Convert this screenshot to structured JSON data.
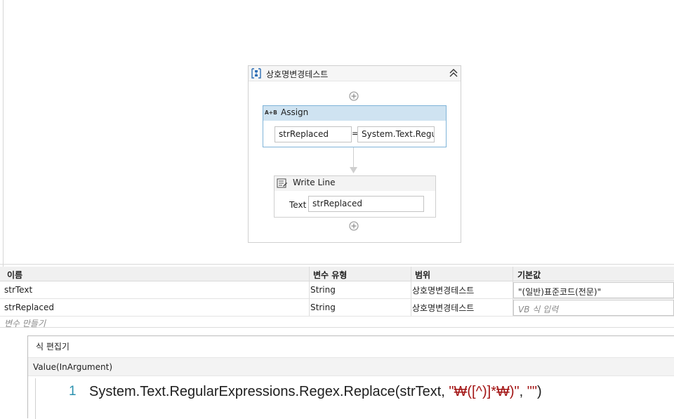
{
  "sequence": {
    "title": "상호명변경테스트",
    "assign": {
      "title": "Assign",
      "icon_label": "A+B",
      "to_value": "strReplaced",
      "equals": "=",
      "value_value": "System.Text.Regul"
    },
    "write_line": {
      "title": "Write Line",
      "text_label": "Text",
      "text_value": "strReplaced"
    }
  },
  "variables": {
    "headers": [
      "이름",
      "변수 유형",
      "범위",
      "기본값"
    ],
    "rows": [
      {
        "name": "strText",
        "type": "String",
        "scope": "상호명변경테스트",
        "default": "\"(일반)표준코드(전문)\""
      },
      {
        "name": "strReplaced",
        "type": "String",
        "scope": "상호명변경테스트",
        "default_placeholder": "VB 식 입력"
      }
    ],
    "create_label": "변수 만들기"
  },
  "expression_editor": {
    "title": "식 편집기",
    "argument_label": "Value(InArgument)",
    "line_number": "1",
    "code_prefix": "System.Text.RegularExpressions.Regex.Replace(strText, ",
    "code_string1": "\"₩([^)]*₩)\"",
    "code_sep": ", ",
    "code_string2": "\"\"",
    "code_suffix": ")"
  },
  "colors": {
    "assign_header": "#cfe3f1",
    "assign_border": "#7fb4d8",
    "string_literal": "#a31515",
    "line_number": "#2b91af"
  }
}
